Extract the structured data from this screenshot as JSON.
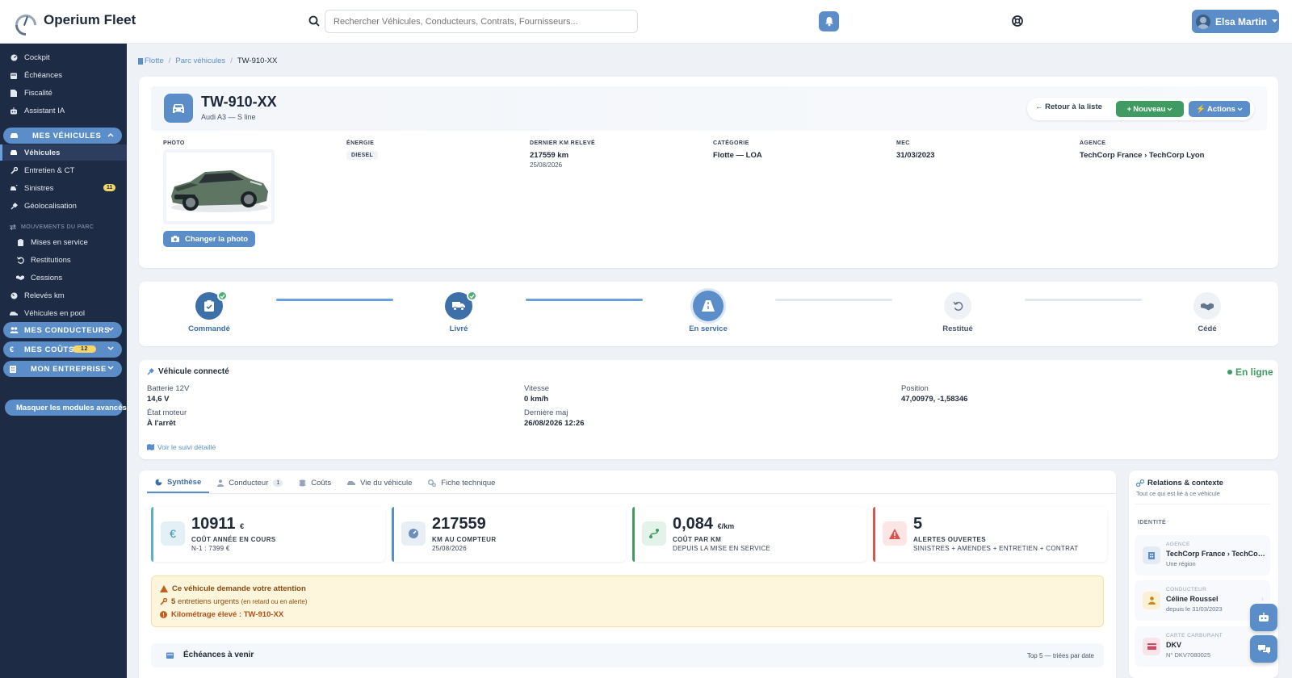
{
  "app": {
    "name": "Operium Fleet"
  },
  "search": {
    "placeholder": "Rechercher Véhicules, Conducteurs, Contrats, Fournisseurs..."
  },
  "user": {
    "name": "Elsa Martin"
  },
  "sidebar": {
    "top_items": [
      {
        "label": "Cockpit",
        "icon": "gauge-icon"
      },
      {
        "label": "Échéances",
        "icon": "calendar-icon"
      },
      {
        "label": "Fiscalité",
        "icon": "document-icon"
      },
      {
        "label": "Assistant IA",
        "icon": "robot-icon"
      }
    ],
    "group_vehicles": "MES VÉHICULES",
    "vehicle_items": [
      {
        "label": "Véhicules",
        "active": true
      },
      {
        "label": "Entretien & CT"
      },
      {
        "label": "Sinistres",
        "badge": "11"
      },
      {
        "label": "Géolocalisation"
      }
    ],
    "section_movements": "MOUVEMENTS DU PARC",
    "movement_items": [
      {
        "label": "Mises en service"
      },
      {
        "label": "Restitutions"
      },
      {
        "label": "Cessions"
      }
    ],
    "other_items": [
      {
        "label": "Relevés km"
      },
      {
        "label": "Véhicules en pool"
      }
    ],
    "group_drivers": "MES CONDUCTEURS",
    "group_costs": "MES COÛTS",
    "group_costs_badge": "12",
    "group_company": "MON ENTREPRISE",
    "hide_modules": "Masquer les modules avancés"
  },
  "breadcrumb": {
    "root": "Flotte",
    "parent": "Parc véhicules",
    "current": "TW-910-XX"
  },
  "vehicle": {
    "plate": "TW-910-XX",
    "model": "Audi A3 — S line",
    "actions": {
      "back": "Retour à la liste",
      "new": "Nouveau",
      "actions": "Actions"
    },
    "photo_label": "PHOTO",
    "change_photo": "Changer la photo",
    "energy_label": "ÉNERGIE",
    "energy": "DIESEL",
    "km_label": "DERNIER KM RELEVÉ",
    "km": "217559 km",
    "km_date": "25/08/2026",
    "category_label": "CATÉGORIE",
    "category": "Flotte — LOA",
    "mec_label": "MEC",
    "mec": "31/03/2023",
    "agency_label": "AGENCE",
    "agency": "TechCorp France › TechCorp Lyon"
  },
  "lifecycle": {
    "steps": [
      {
        "label": "Commandé",
        "state": "done"
      },
      {
        "label": "Livré",
        "state": "done"
      },
      {
        "label": "En service",
        "state": "current"
      },
      {
        "label": "Restitué",
        "state": "pending"
      },
      {
        "label": "Cédé",
        "state": "pending"
      }
    ]
  },
  "connected": {
    "title": "Véhicule connecté",
    "status": "En ligne",
    "battery_label": "Batterie 12V",
    "battery": "14,6 V",
    "engine_label": "État moteur",
    "engine": "À l'arrêt",
    "speed_label": "Vitesse",
    "speed": "0 km/h",
    "updated_label": "Dernière maj",
    "updated": "26/08/2026 12:26",
    "position_label": "Position",
    "position": "47,00979, -1,58346",
    "detail_link": "Voir le suivi détaillé"
  },
  "tabs": [
    {
      "label": "Synthèse",
      "active": true
    },
    {
      "label": "Conducteur",
      "count": "1"
    },
    {
      "label": "Coûts"
    },
    {
      "label": "Vie du véhicule"
    },
    {
      "label": "Fiche technique"
    }
  ],
  "kpis": [
    {
      "value": "10911",
      "unit": "€",
      "label": "COÛT ANNÉE EN COURS",
      "sub": "N-1 : 7399 €",
      "color": "#5ab0c8",
      "icon": "euro-icon"
    },
    {
      "value": "217559",
      "unit": "",
      "label": "KM AU COMPTEUR",
      "sub": "25/08/2026",
      "color": "#5b8ec8",
      "icon": "speedometer-icon"
    },
    {
      "value": "0,084",
      "unit": "€/km",
      "label": "COÛT PAR KM",
      "sub": "DEPUIS LA MISE EN SERVICE",
      "color": "#3f9b62",
      "icon": "route-icon"
    },
    {
      "value": "5",
      "unit": "",
      "label": "ALERTES OUVERTES",
      "sub": "SINISTRES + AMENDES + ENTRETIEN + CONTRAT",
      "color": "#d9534f",
      "icon": "warning-icon"
    }
  ],
  "alert": {
    "title": "Ce véhicule demande votre attention",
    "line1_strong": "5",
    "line1": "entretiens urgents",
    "line1_note": "(en retard ou en alerte)",
    "line2": "Kilométrage élevé : TW-910-XX"
  },
  "deadlines": {
    "title": "Échéances à venir",
    "note": "Top 5 — triées par date"
  },
  "relations": {
    "title": "Relations & contexte",
    "subtitle": "Tout ce qui est lié à ce véhicule",
    "section": "IDENTITÉ",
    "cards": [
      {
        "label": "AGENCE",
        "value": "TechCorp France › TechCorp Lyon",
        "sub": "Une région"
      },
      {
        "label": "CONDUCTEUR",
        "value": "Céline Roussel",
        "sub": "depuis le 31/03/2023"
      },
      {
        "label": "CARTE CARBURANT",
        "value": "DKV",
        "sub": "N° DKV7080025"
      }
    ]
  },
  "colors": {
    "accent": "#5b8ec8",
    "sidebar": "#1e2b44",
    "success": "#3f9b62",
    "danger": "#d9534f",
    "warning": "#c2611f"
  }
}
